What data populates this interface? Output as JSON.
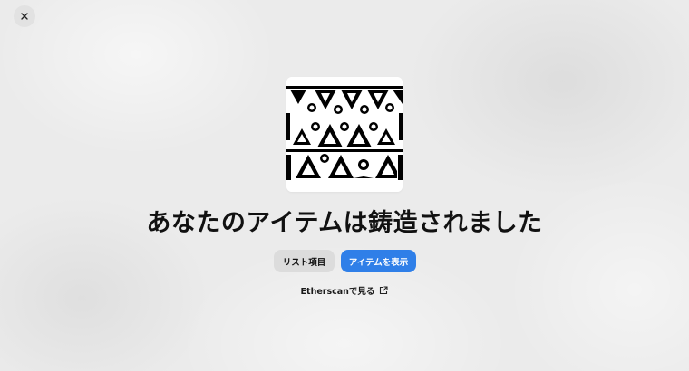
{
  "dialog": {
    "close_icon": "close-icon",
    "title": "あなたのアイテムは鋳造されました",
    "nft_image_description_icon": "nft-pattern"
  },
  "actions": {
    "list_item_label": "リスト項目",
    "view_item_label": "アイテムを表示",
    "etherscan_label": "Etherscanで見る",
    "etherscan_icon": "external-link-icon"
  },
  "colors": {
    "primary": "#2f7fe8",
    "secondary": "#dcdcdc",
    "background": "#ebebeb"
  }
}
